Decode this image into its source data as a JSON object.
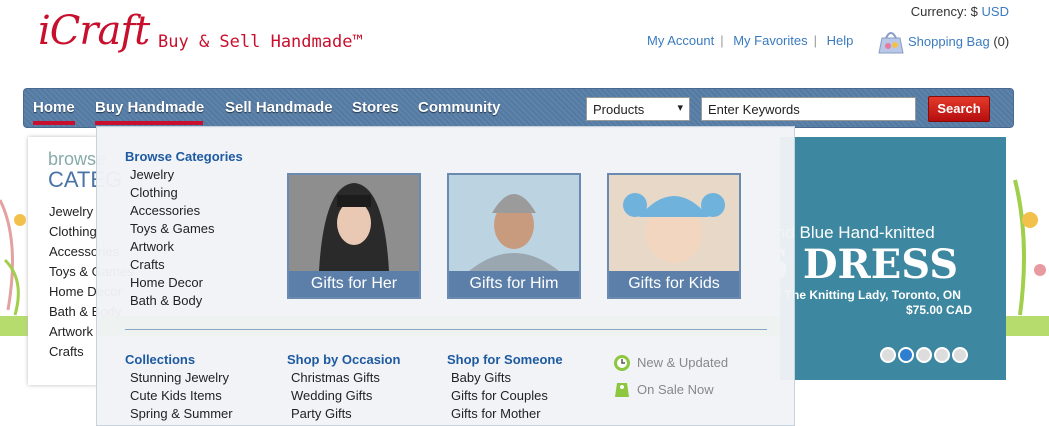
{
  "header": {
    "logo_text": "iCraft",
    "tagline": "Buy & Sell Handmade™",
    "currency_label": "Currency: $",
    "currency_value": "USD",
    "links": [
      "My Account",
      "My Favorites",
      "Help"
    ],
    "bag_label": "Shopping Bag",
    "bag_count": "(0)"
  },
  "nav": {
    "items": [
      "Home",
      "Buy Handmade",
      "Sell Handmade",
      "Stores",
      "Community"
    ],
    "search_scope": "Products",
    "search_placeholder": "Enter Keywords",
    "search_button": "Search"
  },
  "left_panel": {
    "browse": "browse",
    "categories": "CATEG",
    "items": [
      "Jewelry",
      "Clothing",
      "Accessories",
      "Toys & Games",
      "Home Decor",
      "Bath & Body",
      "Artwork",
      "Crafts"
    ]
  },
  "banner": {
    "line1": "ink and Blue Hand-knitted",
    "line2": "S DRESS",
    "line3": "ed by  The Knitting Lady, Toronto, ON",
    "price": "$75.00 CAD",
    "dots": 5,
    "active_dot": 2
  },
  "mega_menu": {
    "browse_heading": "Browse Categories",
    "browse_items": [
      "Jewelry",
      "Clothing",
      "Accessories",
      "Toys & Games",
      "Artwork",
      "Crafts",
      "Home Decor",
      "Bath & Body"
    ],
    "tiles": [
      "Gifts for Her",
      "Gifts for Him",
      "Gifts for Kids"
    ],
    "collections_heading": "Collections",
    "collections_items": [
      "Stunning Jewelry",
      "Cute Kids Items",
      "Spring & Summer"
    ],
    "occasion_heading": "Shop by Occasion",
    "occasion_items": [
      "Christmas Gifts",
      "Wedding Gifts",
      "Party Gifts"
    ],
    "someone_heading": "Shop for Someone",
    "someone_items": [
      "Baby Gifts",
      "Gifts for Couples",
      "Gifts for Mother"
    ],
    "extras": [
      "New & Updated",
      "On Sale Now"
    ]
  },
  "colors": {
    "brand_red": "#c8102e",
    "nav_blue": "#5e83aa",
    "link_blue": "#3a7bbf",
    "heading_blue": "#1e5aa0"
  }
}
